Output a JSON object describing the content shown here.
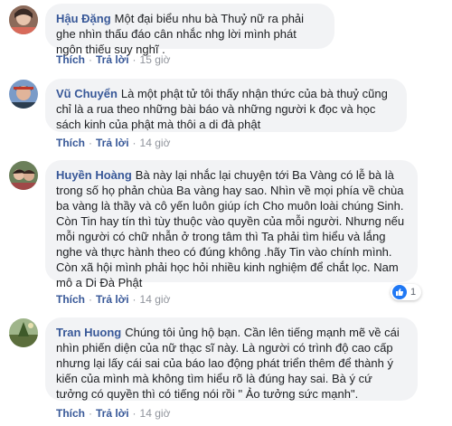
{
  "actions": {
    "like": "Thích",
    "reply": "Trả lời",
    "separator": "·"
  },
  "comments": [
    {
      "name": "Hậu Đặng",
      "text": "Một đại biểu nhu bà Thuỷ nữ ra phải ghe nhìn thấu đáo cân nhắc nhg lời mình phát ngôn thiếu suy nghĩ .",
      "time": "15 giờ"
    },
    {
      "name": "Vũ Chuyển",
      "text": "Là một phật tử tôi thấy nhận thức của bà thuỷ cũng chỉ là a rua theo những bài báo và những người k đọc và học sách kinh của phật mà thôi a di đà phật",
      "time": "14 giờ"
    },
    {
      "name": "Huyền Hoàng",
      "text": "Bà này lại nhắc lại chuyện tới Ba Vàng có lễ bà là trong số họ phản chùa Ba vàng hay sao. Nhìn về mọi phía về chùa ba vàng là thầy và cô yến luôn giúp ích Cho muôn loài chúng Sinh. Còn Tin hay tín thì tùy thuộc vào quyền của mỗi người. Nhưng nếu mỗi người có chữ nhẫn ở trong tâm thì Ta phải tìm hiểu và lắng nghe và thực hành theo có đúng không .hãy Tin vào chính mình. Còn xã hội mình phải học hỏi nhiều kinh nghiệm để chắt lọc. Nam mô a Di Đà Phật",
      "time": "14 giờ",
      "reactions": "1"
    },
    {
      "name": "Tran Huong",
      "text": "Chúng tôi ủng hộ bạn. Cần lên tiếng mạnh mẽ về cái nhìn phiến diện của nữ thạc sĩ này. Là người có trình độ cao cấp nhưng lại lấy cái sai của báo lao động phát triển thêm để thành ý kiến của mình mà không tìm hiểu rõ là đúng hay sai. Bà ý cứ tưởng có quyền thì có tiếng nói rồi \" Ảo tưởng sức mạnh\".",
      "time": "14 giờ"
    }
  ]
}
